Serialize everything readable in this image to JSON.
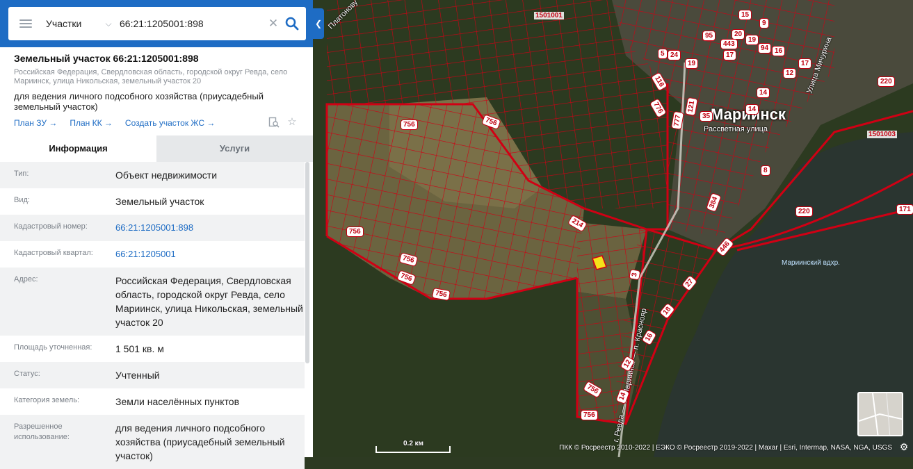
{
  "search": {
    "type_label": "Участки",
    "query": "66:21:1205001:898"
  },
  "object": {
    "title": "Земельный участок 66:21:1205001:898",
    "address_short": "Российская Федерация, Свердловская область, городской округ Ревда, село Мариинск, улица Никольская, земельный участок 20",
    "use": "для ведения личного подсобного хозяйства (приусадебный земельный участок)",
    "links": [
      "План ЗУ →",
      "План КК →",
      "Создать участок ЖС →"
    ]
  },
  "tabs": [
    "Информация",
    "Услуги"
  ],
  "properties": [
    {
      "key": "Тип:",
      "value": "Объект недвижимости"
    },
    {
      "key": "Вид:",
      "value": "Земельный участок"
    },
    {
      "key": "Кадастровый номер:",
      "value": "66:21:1205001:898"
    },
    {
      "key": "Кадастровый квартал:",
      "value": "66:21:1205001"
    },
    {
      "key": "Адрес:",
      "value": "Российская Федерация, Свердловская область, городской округ Ревда, село Мариинск, улица Никольская, земельный участок 20"
    },
    {
      "key": "Площадь уточненная:",
      "value": "1 501 кв. м"
    },
    {
      "key": "Статус:",
      "value": "Учтенный"
    },
    {
      "key": "Категория земель:",
      "value": "Земли населённых пунктов"
    },
    {
      "key": "Разрешенное использование:",
      "value": "для ведения личного подсобного хозяйства (приусадебный земельный участок)"
    }
  ],
  "map": {
    "town": "Мариинск",
    "streets": [
      "Рассветная улица",
      "Улица Мичурина",
      "г. Ревда — с. Мариинск — п. Краснояр",
      "Платонову"
    ],
    "lake": "Мариинский вдхр.",
    "quarter_labels": [
      "1501001",
      "1501003"
    ],
    "parcel_labels": [
      "756",
      "756",
      "756",
      "756",
      "756",
      "756",
      "756",
      "756",
      "214",
      "220",
      "220",
      "171",
      "446",
      "384",
      "8",
      "3",
      "27",
      "18",
      "16",
      "12",
      "14",
      "121",
      "777",
      "776",
      "116",
      "35",
      "19",
      "24",
      "95",
      "443",
      "20",
      "19",
      "94",
      "12",
      "17",
      "14",
      "14",
      "15",
      "9",
      "16",
      "5",
      "17"
    ],
    "scale": "0.2 км",
    "attribution": "ПКК © Росреестр 2010-2022 | ЕЭКО © Росреестр 2019-2022 | Maxar | Esri, Intermap, NASA, NGA, USGS"
  },
  "colors": {
    "primary": "#1e6cc4",
    "parcel_border": "#d00014"
  }
}
